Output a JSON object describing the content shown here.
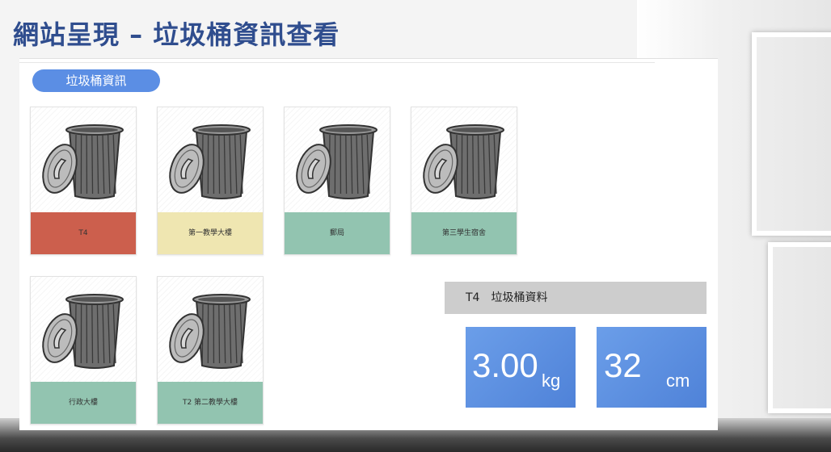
{
  "slide": {
    "title": "網站呈現 – 垃圾桶資訊查看"
  },
  "section": {
    "label": "垃圾桶資訊"
  },
  "bins": [
    {
      "label": "T4",
      "status_color": "#cc5f4d"
    },
    {
      "label": "第一教學大樓",
      "status_color": "#efe6b1"
    },
    {
      "label": "郵局",
      "status_color": "#92c4b0"
    },
    {
      "label": "第三學生宿舍",
      "status_color": "#92c4b0"
    },
    {
      "label": "行政大樓",
      "status_color": "#92c4b0"
    },
    {
      "label": "T2 第二教學大樓",
      "status_color": "#92c4b0"
    }
  ],
  "detail": {
    "header": "T4　垃圾桶資料",
    "weight": {
      "value": "3.00",
      "unit": "kg"
    },
    "height": {
      "value": "32",
      "unit": "cm"
    }
  },
  "colors": {
    "title": "#2f4d8e",
    "accent": "#5b8ee4",
    "full": "#cc5f4d",
    "half": "#efe6b1",
    "ok": "#92c4b0"
  }
}
